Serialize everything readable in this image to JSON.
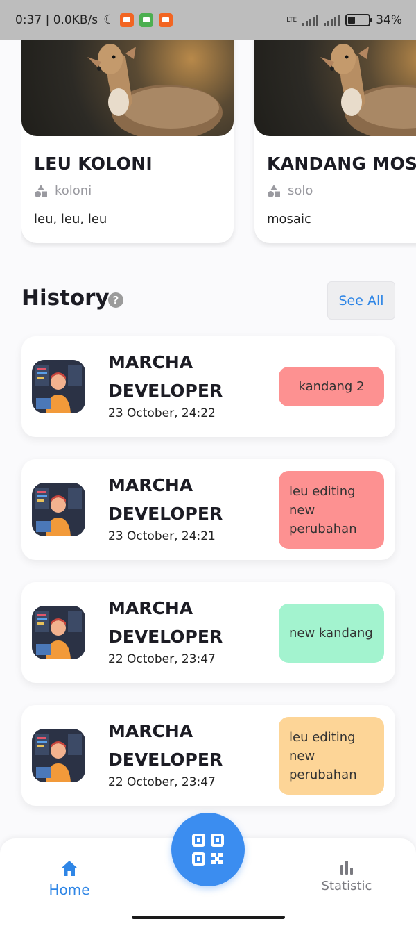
{
  "status_bar": {
    "time_and_speed": "0:37 | 0.0KB/s",
    "network": "LTE",
    "battery": "34%",
    "battery_level": 0.34
  },
  "cages": [
    {
      "title": "LEU KOLONI",
      "type": "koloni",
      "description": "leu, leu, leu"
    },
    {
      "title": "KANDANG MOSAIC",
      "type": "solo",
      "description": "mosaic"
    }
  ],
  "history": {
    "title": "History",
    "help_icon": "?",
    "see_all_label": "See All",
    "items": [
      {
        "name": "MARCHA DEVELOPER",
        "date": "23 October, 24:22",
        "tag": "kandang 2",
        "tag_color": "#fd9191"
      },
      {
        "name": "MARCHA DEVELOPER",
        "date": "23 October, 24:21",
        "tag": "leu editing new perubahan",
        "tag_color": "#fd9191"
      },
      {
        "name": "MARCHA DEVELOPER",
        "date": "22 October, 23:47",
        "tag": "new kandang",
        "tag_color": "#a3f3cf"
      },
      {
        "name": "MARCHA DEVELOPER",
        "date": "22 October, 23:47",
        "tag": "leu editing new perubahan",
        "tag_color": "#fdd597"
      }
    ]
  },
  "nav": {
    "home_label": "Home",
    "statistic_label": "Statistic",
    "scan_icon": "qr-scan-icon"
  },
  "colors": {
    "accent": "#2f86e6",
    "scan_button": "#3b8df0"
  }
}
